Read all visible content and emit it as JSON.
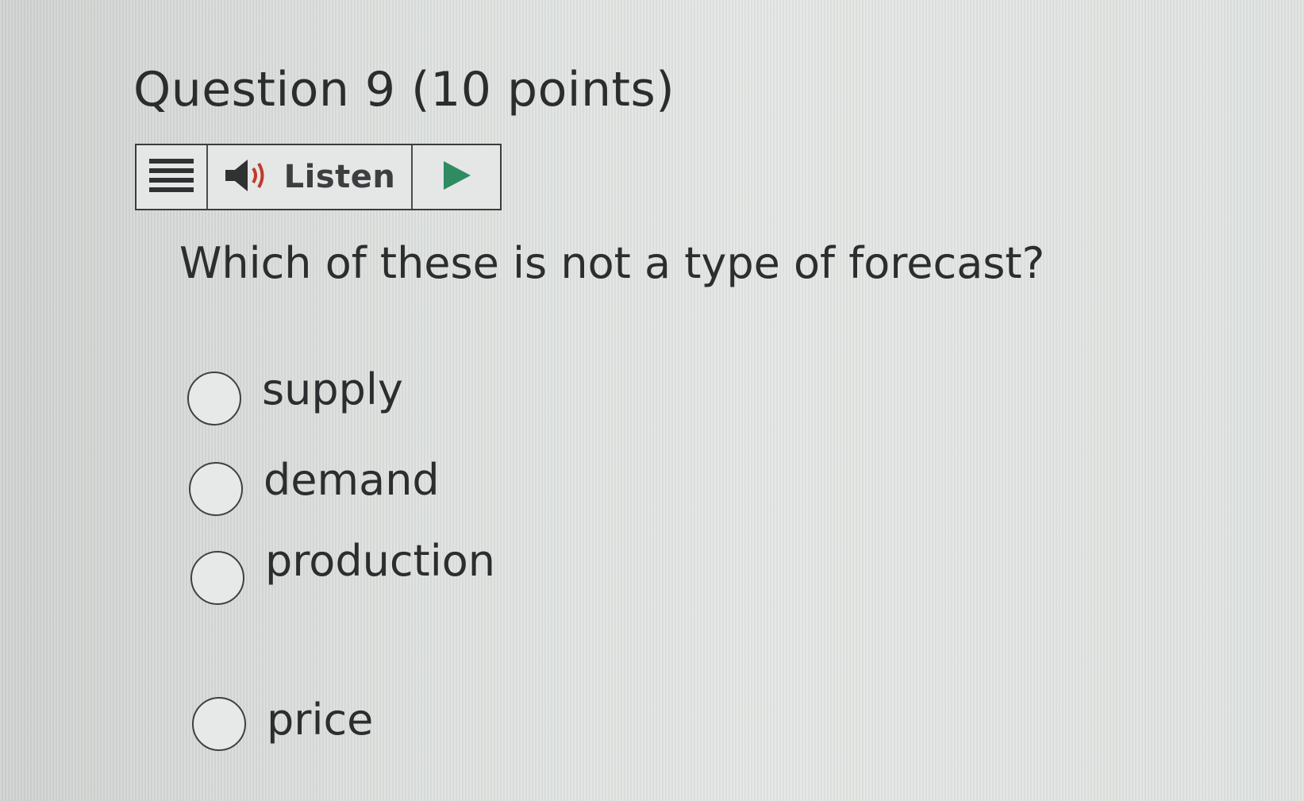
{
  "question": {
    "title": "Question 9 (10 points)",
    "text": "Which of these is not a type of forecast?"
  },
  "listen_bar": {
    "menu_icon": "menu-icon",
    "speaker_icon": "speaker-icon",
    "label": "Listen",
    "play_icon": "play-icon",
    "play_color": "#2e8b62"
  },
  "options": [
    {
      "label": "supply",
      "selected": false
    },
    {
      "label": "demand",
      "selected": false
    },
    {
      "label": "production",
      "selected": false
    },
    {
      "label": "price",
      "selected": false
    }
  ]
}
